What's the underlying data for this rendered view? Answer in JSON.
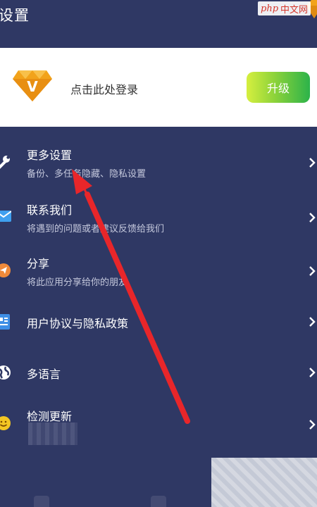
{
  "header": {
    "title": "设置"
  },
  "watermark": {
    "php": "php",
    "site": "中文网"
  },
  "login_card": {
    "prompt": "点击此处登录",
    "upgrade_label": "升级",
    "badge_letter": "V"
  },
  "menu": [
    {
      "title": "更多设置",
      "subtitle": "备份、多任务隐藏、隐私设置",
      "icon": "wrench-icon"
    },
    {
      "title": "联系我们",
      "subtitle": "将遇到的问题或者建议反馈给我们",
      "icon": "mail-icon"
    },
    {
      "title": "分享",
      "subtitle": "将此应用分享给你的朋友",
      "icon": "share-icon"
    },
    {
      "title": "用户协议与隐私政策",
      "subtitle": "",
      "icon": "document-icon"
    },
    {
      "title": "多语言",
      "subtitle": "",
      "icon": "globe-icon"
    },
    {
      "title": "检测更新",
      "subtitle": "",
      "icon": "smiley-icon"
    }
  ],
  "colors": {
    "background": "#2f3864",
    "card": "#ffffff",
    "accent_gold": "#f2a31b",
    "upgrade_gradient_start": "#d6ef3f",
    "upgrade_gradient_end": "#2cb34a",
    "annotation_arrow": "#e8262a"
  }
}
